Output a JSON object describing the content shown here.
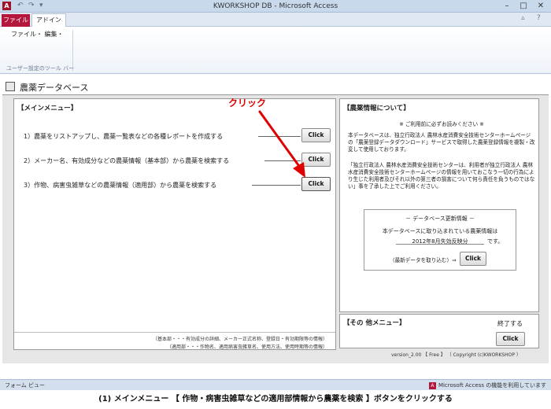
{
  "window": {
    "title": "KWORKSHOP DB - Microsoft Access",
    "app_icon": "A",
    "minimize": "–",
    "maximize": "□",
    "close": "✕",
    "quick_access": [
      "↶",
      "↷",
      "▾"
    ]
  },
  "ribbon": {
    "tabs": [
      "ファイル",
      "アドイン"
    ],
    "menu": "ファイル・ 編集・",
    "group_label": "ユーザー設定のツール バー",
    "right_icons": [
      "▵",
      "?"
    ]
  },
  "form": {
    "title": "農薬データベース"
  },
  "main_menu": {
    "heading": "【メインメニュー】",
    "items": [
      {
        "label": "1）農薬をリストアップし、農薬一覧表などの各種レポートを作成する",
        "button": "Click"
      },
      {
        "label": "2）メーカー名、有効成分などの農薬情報（基本部）から農薬を検索する",
        "button": "Click"
      },
      {
        "label": "3）作物、病害虫雑草などの農薬情報（適用部）から農薬を検索する",
        "button": "Click"
      }
    ],
    "footnotes": [
      "（基本部・・・有効成分の詳細、メーカー正式名称、登録日・有効期限等の情報）",
      "（適用部・・・作物名、適用病害虫雑草名、使用方法、使用時期等の情報）"
    ]
  },
  "annotation": {
    "label": "クリック",
    "color": "#e00000"
  },
  "info": {
    "heading": "【農薬情報について】",
    "notice": "※ ご利用前に必ずお読みください ※",
    "para1": "本データベースは、独立行政法人 農林水産消費安全技術センターホームページの「農薬登録データダウンロード」サービスで取得した農薬登録情報を複製・改変して使用しております。",
    "para2": "「独立行政法人 農林水産消費安全技術センターは、利用者が独立行政法人 農林水産消費安全技術センターホームページの情報を用いておこなう一切の行為により生じた利用者及びそれ以外の第三者の損害について何ら責任を負うものではない」事を了承した上でご利用ください。",
    "update": {
      "title": "－ データベース更新情報 －",
      "line1": "本データベースに取り込まれている農薬情報は",
      "date": "2012年8月失効反映分",
      "suffix": "です。",
      "import_label": "（最新データを取り込む）⇒",
      "button": "Click"
    }
  },
  "other_menu": {
    "heading": "【その 他メニュー】",
    "exit_label": "終了する",
    "button": "Click"
  },
  "version": "version_2.00 【 Free 】 （ Copyright (c)KWORKSHOP ）",
  "status_bar": {
    "left": "フォーム ビュー",
    "right": "Microsoft Access の機能を利用しています",
    "icon": "A"
  },
  "caption": "(1) メインメニュー 【 作物・病害虫雑草などの適用部情報から農薬を検索 】ボタンをクリックする"
}
